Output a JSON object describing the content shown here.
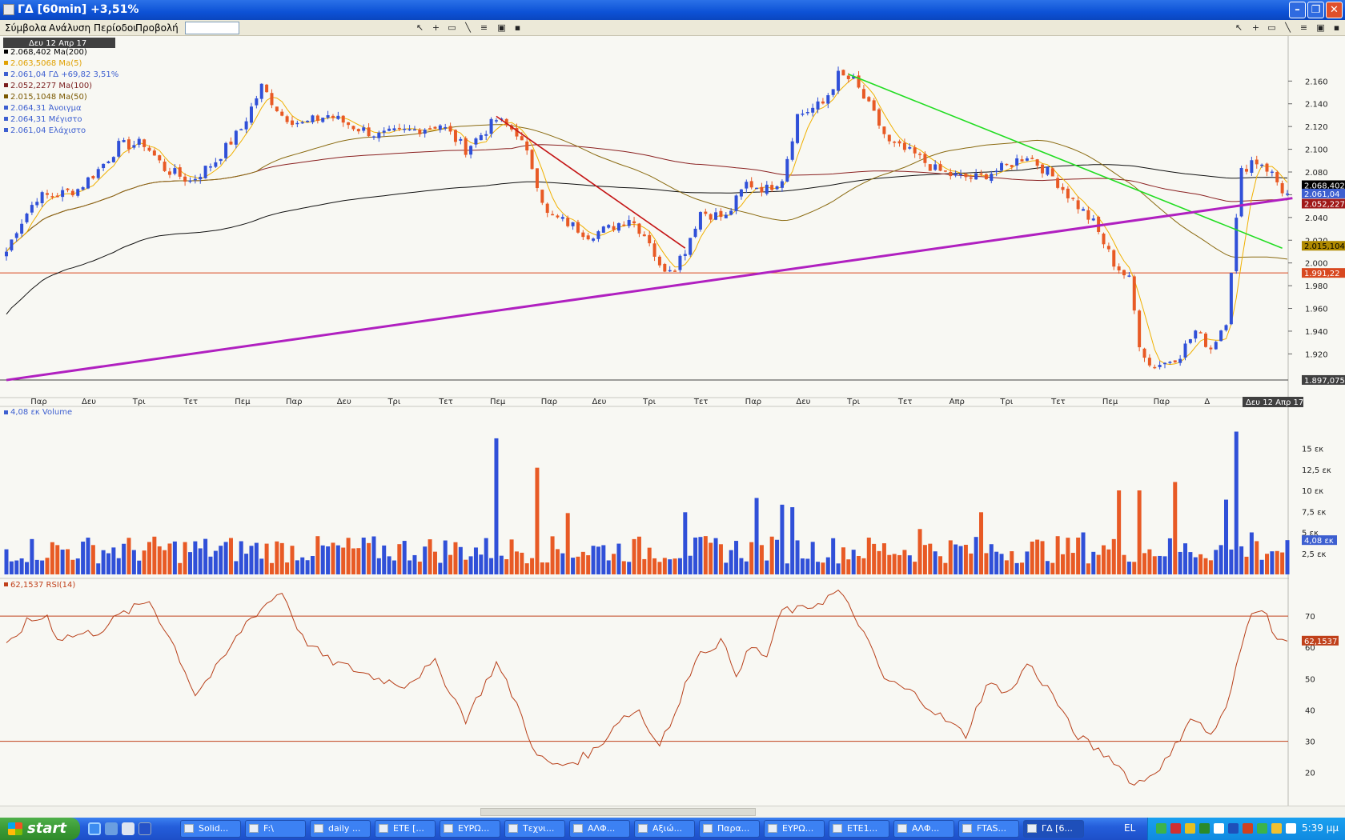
{
  "window": {
    "title": "ΓΔ [60min] +3,51%"
  },
  "menu": [
    {
      "label": "Σύμβολα"
    },
    {
      "label": "Ανάλυση"
    },
    {
      "label": "Περίοδοι"
    },
    {
      "label": "Προβολή"
    }
  ],
  "toolbar": {
    "icons": [
      "cursor-icon",
      "crosshair-icon",
      "rectangle-icon",
      "line-icon",
      "hatch-icon",
      "chart-icon",
      "save-icon"
    ]
  },
  "chart_data": [
    {
      "type": "candlestick",
      "panel": "price",
      "date_label": "Δευ 12 Απρ 17",
      "legend": [
        {
          "text": "2.068,402 Ma(200)",
          "color": "#000000"
        },
        {
          "text": "2.063,5068 Ma(5)",
          "color": "#e0a000"
        },
        {
          "text": "2.061,04 ΓΔ +69,82 3,51%",
          "color": "#3d5fd0"
        },
        {
          "text": "2.052,2277 Ma(100)",
          "color": "#7a1e1e"
        },
        {
          "text": "2.015,1048 Ma(50)",
          "color": "#7a5800"
        },
        {
          "text": "2.064,31 Άνοιγμα",
          "color": "#3d5fd0"
        },
        {
          "text": "2.064,31 Μέγιστο",
          "color": "#3d5fd0"
        },
        {
          "text": "2.061,04 Ελάχιστο",
          "color": "#3d5fd0"
        }
      ],
      "ylim": [
        1890,
        2175
      ],
      "yticks": [
        "2.160",
        "2.140",
        "2.120",
        "2.100",
        "2.080",
        "2.060",
        "2.040",
        "2.020",
        "2.000",
        "1.980",
        "1.960",
        "1.940",
        "1.920"
      ],
      "ytick_values": [
        2160,
        2140,
        2120,
        2100,
        2080,
        2060,
        2040,
        2020,
        2000,
        1980,
        1960,
        1940,
        1920
      ],
      "xticks": [
        "Παρ",
        "Δευ",
        "Τρι",
        "Τετ",
        "Πεμ",
        "Παρ",
        "Δευ",
        "Τρι",
        "Τετ",
        "Πεμ",
        "Παρ",
        "Δευ",
        "Τρι",
        "Τετ",
        "Παρ",
        "Δευ",
        "Τρι",
        "Τετ",
        "Απρ",
        "Τρι",
        "Τετ",
        "Πεμ",
        "Παρ",
        "Δ"
      ],
      "xtick_bars": [
        6,
        16,
        26,
        36,
        46,
        56,
        66,
        76,
        86,
        96,
        106,
        116,
        126,
        136,
        146,
        156,
        166,
        176,
        186,
        196,
        206,
        216,
        226,
        236
      ],
      "price_labels": [
        {
          "text": "2.068,402",
          "value": 2068.4,
          "bg": "#000000",
          "fg": "#ffffff"
        },
        {
          "text": "2.061,04",
          "value": 2061.04,
          "bg": "#3d5fd0",
          "fg": "#ffffff"
        },
        {
          "text": "2.052,227",
          "value": 2052.2,
          "bg": "#a01818",
          "fg": "#ffffff"
        },
        {
          "text": "2.015,104",
          "value": 2015.1,
          "bg": "#b08a00",
          "fg": "#000000"
        },
        {
          "text": "1.991,22",
          "value": 1991.22,
          "bg": "#d84820",
          "fg": "#ffffff"
        },
        {
          "text": "1.897,075",
          "value": 1897.075,
          "bg": "#404040",
          "fg": "#ffffff"
        }
      ],
      "hlines": [
        {
          "value": 1991.22,
          "color": "#d84820"
        },
        {
          "value": 1897.075,
          "color": "#404040"
        }
      ],
      "trendlines": [
        {
          "color": "#c41515",
          "from": [
            96,
            2129
          ],
          "to": [
            133,
            2013
          ]
        },
        {
          "color": "#22dd22",
          "from": [
            165,
            2166
          ],
          "to": [
            250,
            2013
          ]
        },
        {
          "color": "#b020c0",
          "from": [
            0,
            1897
          ],
          "to": [
            252,
            2057
          ]
        }
      ],
      "anchors": [
        [
          0,
          2010
        ],
        [
          2,
          2030
        ],
        [
          6,
          2058
        ],
        [
          10,
          2060
        ],
        [
          14,
          2065
        ],
        [
          18,
          2082
        ],
        [
          22,
          2103
        ],
        [
          27,
          2105
        ],
        [
          31,
          2083
        ],
        [
          36,
          2072
        ],
        [
          41,
          2090
        ],
        [
          46,
          2118
        ],
        [
          50,
          2155
        ],
        [
          54,
          2130
        ],
        [
          58,
          2122
        ],
        [
          63,
          2130
        ],
        [
          68,
          2120
        ],
        [
          73,
          2112
        ],
        [
          80,
          2117
        ],
        [
          85,
          2122
        ],
        [
          90,
          2100
        ],
        [
          96,
          2126
        ],
        [
          100,
          2115
        ],
        [
          103,
          2085
        ],
        [
          106,
          2042
        ],
        [
          110,
          2035
        ],
        [
          114,
          2025
        ],
        [
          118,
          2030
        ],
        [
          122,
          2040
        ],
        [
          126,
          2020
        ],
        [
          128,
          1995
        ],
        [
          131,
          1998
        ],
        [
          133,
          2012
        ],
        [
          136,
          2045
        ],
        [
          141,
          2040
        ],
        [
          145,
          2070
        ],
        [
          149,
          2065
        ],
        [
          152,
          2075
        ],
        [
          155,
          2130
        ],
        [
          160,
          2140
        ],
        [
          163,
          2165
        ],
        [
          166,
          2160
        ],
        [
          170,
          2130
        ],
        [
          173,
          2105
        ],
        [
          178,
          2095
        ],
        [
          182,
          2082
        ],
        [
          186,
          2076
        ],
        [
          190,
          2075
        ],
        [
          195,
          2083
        ],
        [
          200,
          2095
        ],
        [
          205,
          2076
        ],
        [
          208,
          2060
        ],
        [
          213,
          2035
        ],
        [
          217,
          2000
        ],
        [
          220,
          1985
        ],
        [
          222,
          1930
        ],
        [
          224,
          1910
        ],
        [
          227,
          1912
        ],
        [
          230,
          1920
        ],
        [
          233,
          1940
        ],
        [
          236,
          1925
        ],
        [
          239,
          1950
        ],
        [
          240,
          1995
        ],
        [
          242,
          2080
        ],
        [
          244,
          2090
        ],
        [
          246,
          2088
        ],
        [
          248,
          2078
        ],
        [
          250,
          2064
        ],
        [
          251,
          2061
        ]
      ]
    },
    {
      "type": "bar",
      "panel": "volume",
      "legend": "4,08 εκ Volume",
      "ylim": [
        0,
        20
      ],
      "yticks": [
        "15 εκ",
        "12,5 εκ",
        "10 εκ",
        "7,5 εκ",
        "5 εκ",
        "2,5 εκ"
      ],
      "ytick_values": [
        15,
        12.5,
        10,
        7.5,
        5,
        2.5
      ],
      "last_label": "4,08 εκ",
      "last_value": 4.08,
      "spikes": [
        [
          96,
          16.2
        ],
        [
          104,
          12.7
        ],
        [
          110,
          7.3
        ],
        [
          133,
          7.4
        ],
        [
          147,
          9.1
        ],
        [
          152,
          8.3
        ],
        [
          154,
          8.0
        ],
        [
          179,
          5.4
        ],
        [
          191,
          7.4
        ],
        [
          211,
          5.0
        ],
        [
          218,
          10.0
        ],
        [
          222,
          10.0
        ],
        [
          229,
          11.0
        ],
        [
          239,
          8.9
        ],
        [
          241,
          17.0
        ],
        [
          244,
          5.0
        ]
      ]
    },
    {
      "type": "line",
      "panel": "rsi",
      "legend": "62,1537 RSI(14)",
      "ylim": [
        12,
        80
      ],
      "yticks": [
        "70",
        "60",
        "50",
        "40",
        "30",
        "20"
      ],
      "ytick_values": [
        70,
        60,
        50,
        40,
        30,
        20
      ],
      "hlines": [
        70,
        30
      ],
      "last_label": "62,1537",
      "last_value": 62.1537,
      "points": [
        [
          0,
          60
        ],
        [
          4,
          68
        ],
        [
          8,
          70
        ],
        [
          10,
          63
        ],
        [
          14,
          64
        ],
        [
          18,
          65
        ],
        [
          22,
          70
        ],
        [
          28,
          75
        ],
        [
          33,
          60
        ],
        [
          37,
          45
        ],
        [
          42,
          55
        ],
        [
          47,
          68
        ],
        [
          51,
          74
        ],
        [
          54,
          78
        ],
        [
          58,
          63
        ],
        [
          63,
          56
        ],
        [
          68,
          53
        ],
        [
          73,
          50
        ],
        [
          78,
          48
        ],
        [
          84,
          55
        ],
        [
          90,
          37
        ],
        [
          96,
          55
        ],
        [
          100,
          42
        ],
        [
          104,
          25
        ],
        [
          108,
          22
        ],
        [
          112,
          24
        ],
        [
          116,
          28
        ],
        [
          120,
          37
        ],
        [
          124,
          40
        ],
        [
          126,
          33
        ],
        [
          128,
          30
        ],
        [
          131,
          38
        ],
        [
          135,
          57
        ],
        [
          140,
          62
        ],
        [
          143,
          52
        ],
        [
          146,
          60
        ],
        [
          149,
          57
        ],
        [
          152,
          72
        ],
        [
          156,
          72
        ],
        [
          160,
          75
        ],
        [
          163,
          78
        ],
        [
          167,
          68
        ],
        [
          172,
          50
        ],
        [
          178,
          45
        ],
        [
          183,
          38
        ],
        [
          188,
          32
        ],
        [
          192,
          48
        ],
        [
          197,
          46
        ],
        [
          200,
          55
        ],
        [
          205,
          45
        ],
        [
          209,
          33
        ],
        [
          213,
          28
        ],
        [
          217,
          24
        ],
        [
          221,
          16
        ],
        [
          224,
          19
        ],
        [
          228,
          25
        ],
        [
          232,
          38
        ],
        [
          236,
          32
        ],
        [
          239,
          40
        ],
        [
          242,
          60
        ],
        [
          244,
          72
        ],
        [
          246,
          73
        ],
        [
          249,
          63
        ],
        [
          251,
          62
        ]
      ]
    }
  ],
  "taskbar": {
    "start": "start",
    "tasks": [
      {
        "label": "Solid..."
      },
      {
        "label": "F:\\"
      },
      {
        "label": "daily ..."
      },
      {
        "label": "ΕΤΕ [..."
      },
      {
        "label": "ΕΥΡΩ..."
      },
      {
        "label": "Τεχνι..."
      },
      {
        "label": "ΑΛΦ..."
      },
      {
        "label": "Αξιώ..."
      },
      {
        "label": "Παρα..."
      },
      {
        "label": "ΕΥΡΩ..."
      },
      {
        "label": "ΕΤΕ1..."
      },
      {
        "label": "ΑΛΦ..."
      },
      {
        "label": "FTAS..."
      },
      {
        "label": "ΓΔ [6..."
      }
    ],
    "lang": "EL",
    "clock": "5:39 μμ"
  }
}
